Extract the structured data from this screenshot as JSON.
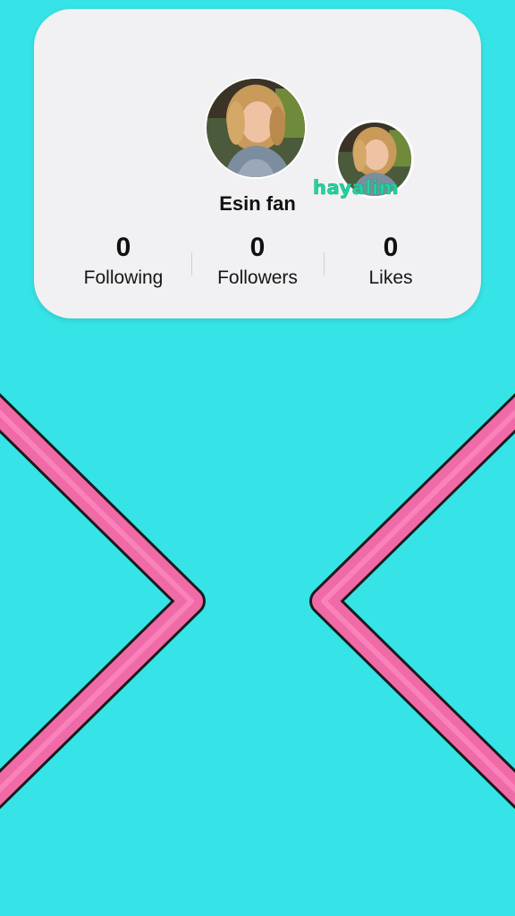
{
  "profile": {
    "username": "Esin fan",
    "sticker_text": "hayalim",
    "avatar_icon": "profile-photo",
    "badge_avatar_icon": "profile-photo-small"
  },
  "stats": [
    {
      "value": "0",
      "label": "Following"
    },
    {
      "value": "0",
      "label": "Followers"
    },
    {
      "value": "0",
      "label": "Likes"
    }
  ],
  "colors": {
    "background": "#36e3e6",
    "card": "#f1f0f2",
    "neon_pink": "#f06aa8",
    "sticker_green": "#1fd59f"
  }
}
